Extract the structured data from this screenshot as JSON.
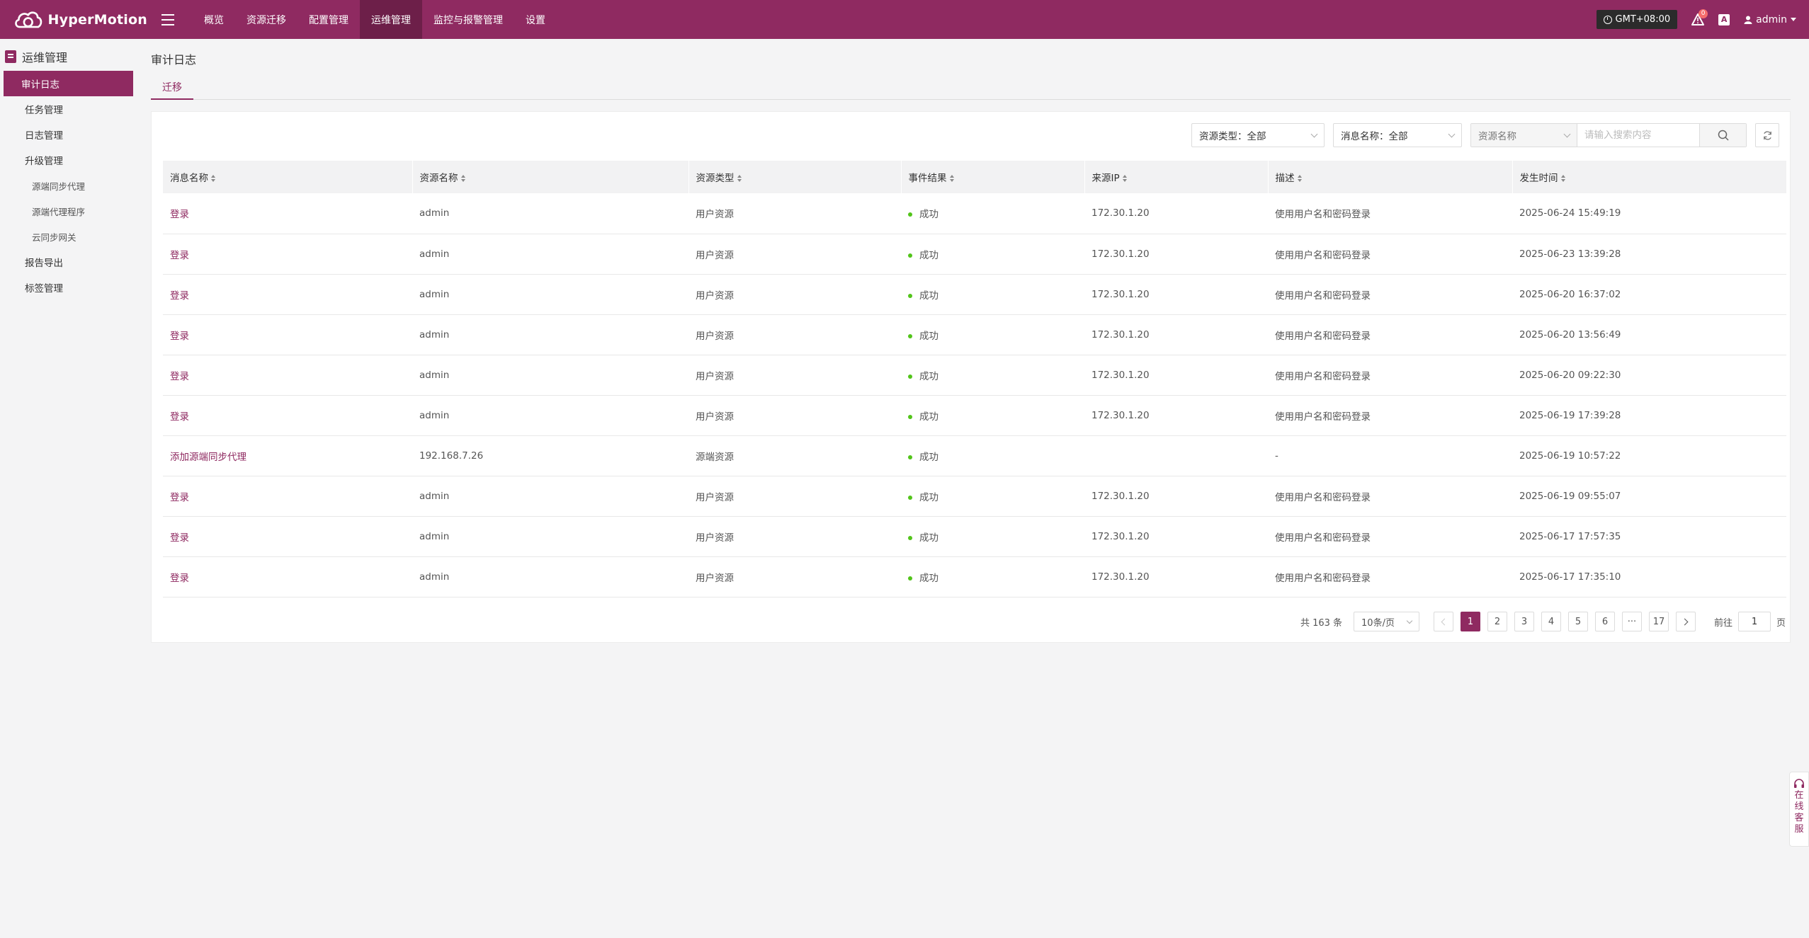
{
  "header": {
    "brand": "HyperMotion",
    "nav": [
      "概览",
      "资源迁移",
      "配置管理",
      "运维管理",
      "监控与报警管理",
      "设置"
    ],
    "active_nav_index": 3,
    "timezone": "GMT+08:00",
    "notification_count": "0",
    "lang_icon_text": "A",
    "user": "admin",
    "brand_color": "#8f2a61"
  },
  "sidebar": {
    "title": "运维管理",
    "items": [
      {
        "label": "审计日志",
        "level": 1,
        "active": true
      },
      {
        "label": "任务管理",
        "level": 1
      },
      {
        "label": "日志管理",
        "level": 1
      },
      {
        "label": "升级管理",
        "level": 1
      },
      {
        "label": "源端同步代理",
        "level": 2
      },
      {
        "label": "源端代理程序",
        "level": 2
      },
      {
        "label": "云同步网关",
        "level": 2
      },
      {
        "label": "报告导出",
        "level": 1
      },
      {
        "label": "标签管理",
        "level": 1
      }
    ]
  },
  "page": {
    "title": "审计日志",
    "tab": "迁移"
  },
  "filters": {
    "resource_type": "资源类型：全部",
    "message_name": "消息名称：全部",
    "search_field": "资源名称",
    "search_placeholder": "请输入搜索内容"
  },
  "table": {
    "columns": [
      "消息名称",
      "资源名称",
      "资源类型",
      "事件结果",
      "来源IP",
      "描述",
      "发生时间"
    ],
    "rows": [
      [
        "登录",
        "admin",
        "用户资源",
        "成功",
        "172.30.1.20",
        "使用用户名和密码登录",
        "2025-06-24 15:49:19"
      ],
      [
        "登录",
        "admin",
        "用户资源",
        "成功",
        "172.30.1.20",
        "使用用户名和密码登录",
        "2025-06-23 13:39:28"
      ],
      [
        "登录",
        "admin",
        "用户资源",
        "成功",
        "172.30.1.20",
        "使用用户名和密码登录",
        "2025-06-20 16:37:02"
      ],
      [
        "登录",
        "admin",
        "用户资源",
        "成功",
        "172.30.1.20",
        "使用用户名和密码登录",
        "2025-06-20 13:56:49"
      ],
      [
        "登录",
        "admin",
        "用户资源",
        "成功",
        "172.30.1.20",
        "使用用户名和密码登录",
        "2025-06-20 09:22:30"
      ],
      [
        "登录",
        "admin",
        "用户资源",
        "成功",
        "172.30.1.20",
        "使用用户名和密码登录",
        "2025-06-19 17:39:28"
      ],
      [
        "添加源端同步代理",
        "192.168.7.26",
        "源端资源",
        "成功",
        "",
        "-",
        "2025-06-19 10:57:22"
      ],
      [
        "登录",
        "admin",
        "用户资源",
        "成功",
        "172.30.1.20",
        "使用用户名和密码登录",
        "2025-06-19 09:55:07"
      ],
      [
        "登录",
        "admin",
        "用户资源",
        "成功",
        "172.30.1.20",
        "使用用户名和密码登录",
        "2025-06-17 17:57:35"
      ],
      [
        "登录",
        "admin",
        "用户资源",
        "成功",
        "172.30.1.20",
        "使用用户名和密码登录",
        "2025-06-17 17:35:10"
      ]
    ],
    "success_color": "#52c41a"
  },
  "pagination": {
    "total": "共 163 条",
    "page_size": "10条/页",
    "pages": [
      "1",
      "2",
      "3",
      "4",
      "5",
      "6",
      "···",
      "17"
    ],
    "current": "1",
    "goto_label": "前往",
    "goto_value": "1",
    "goto_suffix": "页"
  },
  "floating": {
    "customer_service": [
      "在",
      "线",
      "客",
      "服"
    ]
  }
}
